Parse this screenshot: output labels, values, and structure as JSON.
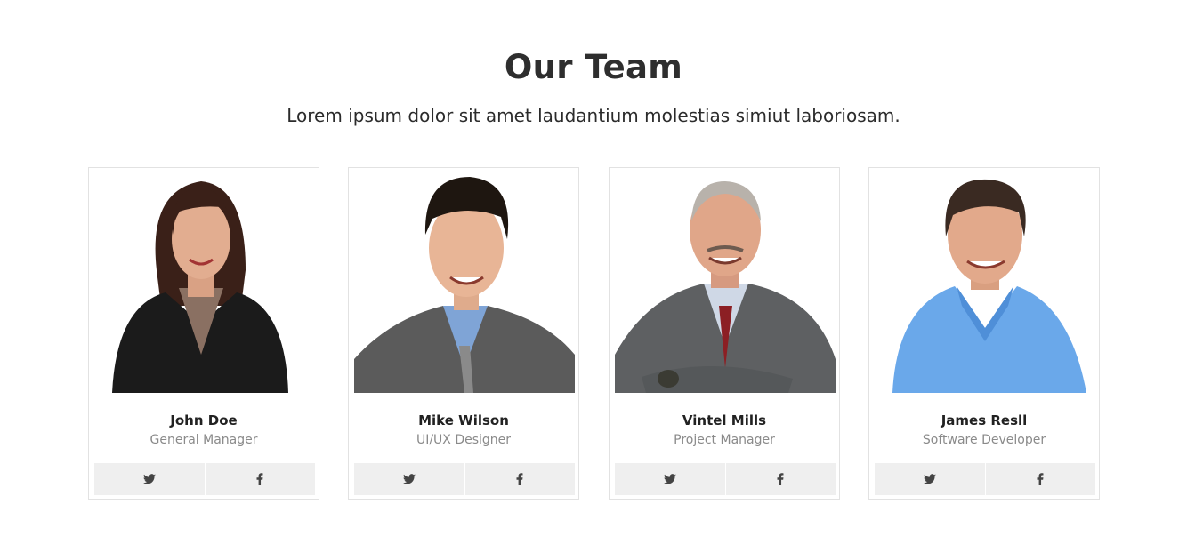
{
  "header": {
    "title": "Our Team",
    "subtitle": "Lorem ipsum dolor sit amet laudantium molestias simiut laboriosam."
  },
  "team": [
    {
      "name": "John Doe",
      "role": "General Manager",
      "photo_icon": "woman-portrait-photo",
      "social": [
        "twitter-icon",
        "facebook-icon"
      ]
    },
    {
      "name": "Mike Wilson",
      "role": "UI/UX Designer",
      "photo_icon": "man-portrait-photo",
      "social": [
        "twitter-icon",
        "facebook-icon"
      ]
    },
    {
      "name": "Vintel Mills",
      "role": "Project Manager",
      "photo_icon": "man-portrait-photo",
      "social": [
        "twitter-icon",
        "facebook-icon"
      ]
    },
    {
      "name": "James Resll",
      "role": "Software Developer",
      "photo_icon": "man-portrait-photo",
      "social": [
        "twitter-icon",
        "facebook-icon"
      ]
    }
  ],
  "colors": {
    "button_bg": "#efefef",
    "card_border": "#e2e2e2",
    "role_text": "#8a8a8a"
  }
}
